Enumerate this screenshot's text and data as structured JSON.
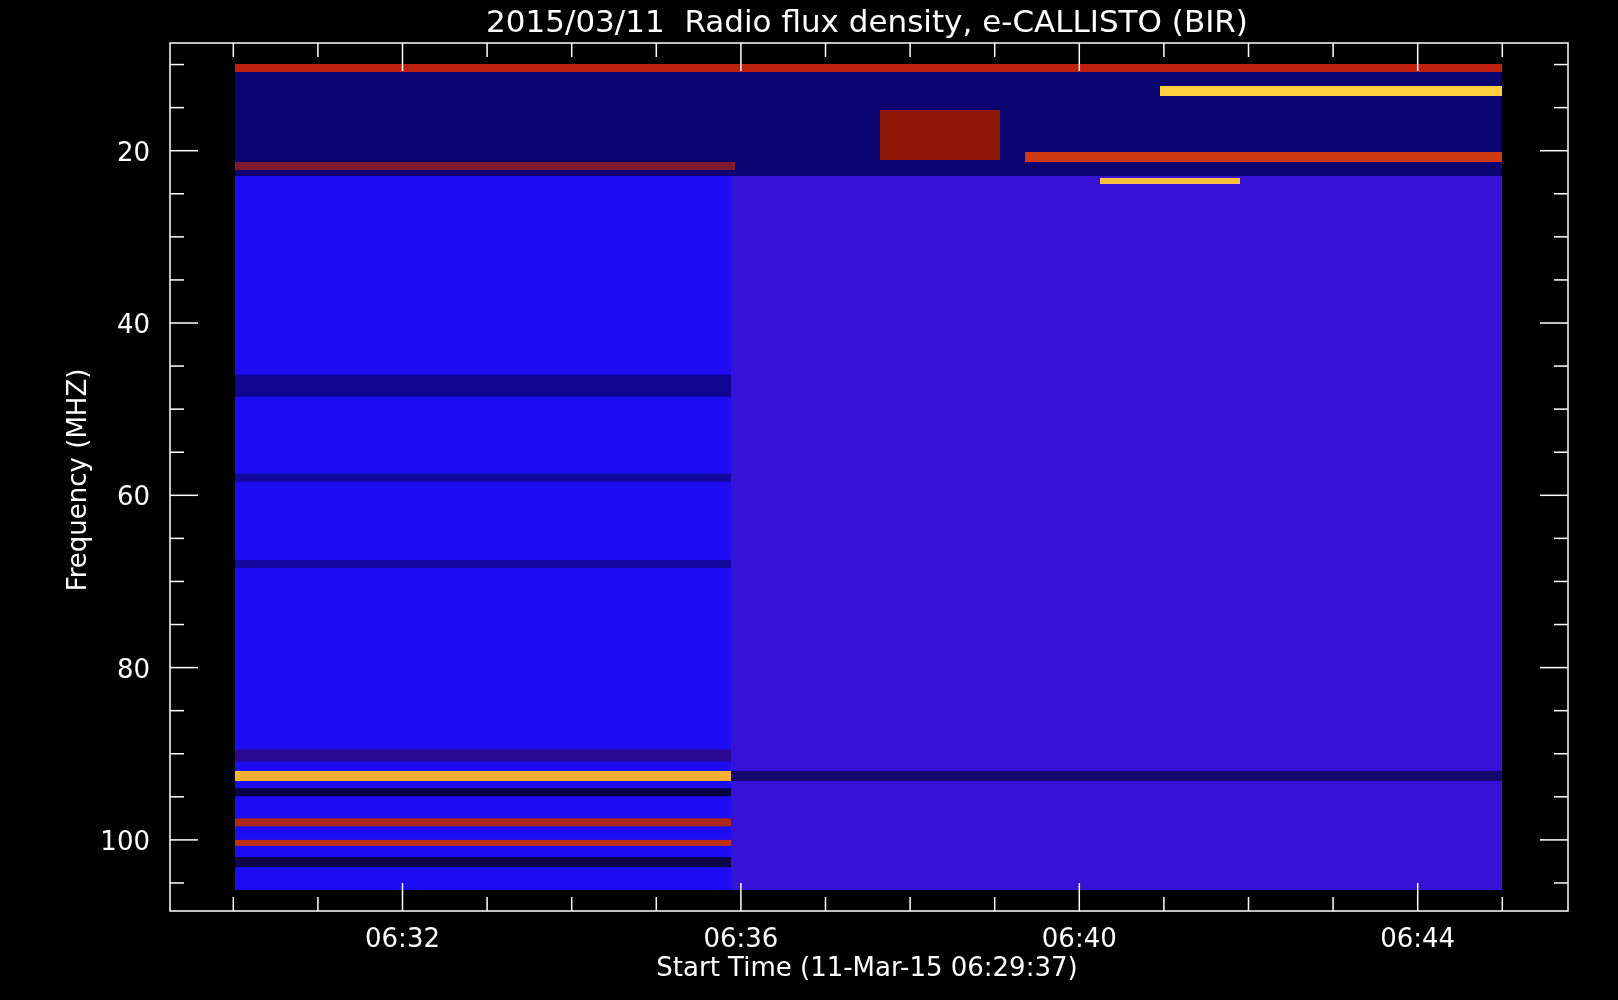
{
  "title": "2015/03/11  Radio flux density, e-CALLISTO (BIR)",
  "y_axis": {
    "label": "Frequency (MHZ)",
    "tick_labels": [
      "20",
      "40",
      "60",
      "80",
      "100"
    ]
  },
  "x_axis": {
    "label": "Start Time (11-Mar-15 06:29:37)",
    "tick_labels": [
      "06:32",
      "06:36",
      "06:40",
      "06:44"
    ]
  }
}
